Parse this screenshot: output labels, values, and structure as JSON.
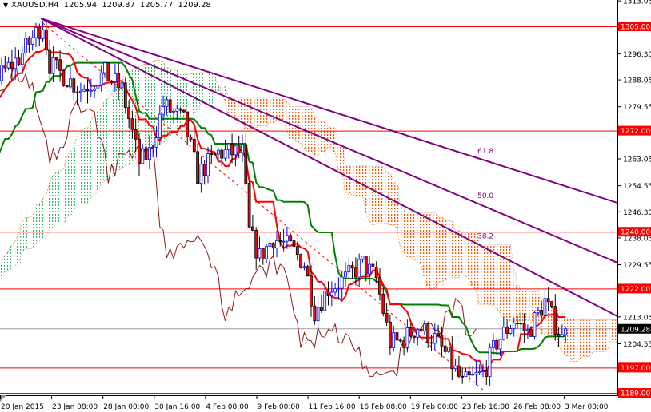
{
  "header": {
    "symbol": "XAUUSD,H4",
    "open": "1205.94",
    "high": "1209.87",
    "low": "1205.77",
    "close": "1209.28"
  },
  "chart_data": {
    "type": "candlestick",
    "title": "XAUUSD,H4",
    "ylim": [
      1187,
      1314
    ],
    "bars_visible": 165,
    "price_ticks": [
      "1313.05",
      "1296.30",
      "1288.05",
      "1279.55",
      "1263.05",
      "1254.55",
      "1246.30",
      "1238.05",
      "1229.55",
      "1213.05",
      "1204.55"
    ],
    "time_ticks": [
      "20 Jan 2015",
      "23 Jan 08:00",
      "28 Jan 00:00",
      "30 Jan 16:00",
      "4 Feb 08:00",
      "9 Feb 00:00",
      "11 Feb 16:00",
      "16 Feb 08:00",
      "19 Feb 00:00",
      "23 Feb 16:00",
      "26 Feb 08:00",
      "3 Mar 00:00"
    ],
    "horizontal_levels": [
      {
        "price": 1305.0,
        "label": "1305.00"
      },
      {
        "price": 1272.0,
        "label": "1272.00"
      },
      {
        "price": 1240.0,
        "label": "1240.00"
      },
      {
        "price": 1222.0,
        "label": "1222.00"
      },
      {
        "price": 1197.0,
        "label": "1197.00"
      },
      {
        "price": 1189.0,
        "label": "1189.00"
      }
    ],
    "current_price": {
      "price": 1209.28,
      "label": "1209.28"
    },
    "fan_lines": [
      {
        "label": "61.8",
        "start": [
          11.5,
          1307.5
        ],
        "end": [
          179.5,
          1249
        ],
        "label_bar": 137
      },
      {
        "label": "50.0",
        "start": [
          11.5,
          1307.5
        ],
        "end": [
          179.5,
          1230
        ],
        "label_bar": 137
      },
      {
        "label": "38.2",
        "start": [
          11.5,
          1307.5
        ],
        "end": [
          179.5,
          1213
        ],
        "label_bar": 137
      }
    ],
    "dashed_trend": {
      "start": [
        12,
        1306
      ],
      "end": [
        140,
        1190
      ]
    },
    "prehistory_closes": [
      [
        -52,
        1212
      ],
      [
        -40,
        1222
      ],
      [
        -30,
        1235
      ],
      [
        -20,
        1255
      ],
      [
        -10,
        1275
      ],
      [
        0,
        1290
      ]
    ],
    "key_closes": [
      [
        0,
        1290
      ],
      [
        5,
        1295
      ],
      [
        12,
        1306
      ],
      [
        14,
        1293
      ],
      [
        23,
        1285
      ],
      [
        30,
        1290
      ],
      [
        35,
        1285
      ],
      [
        40,
        1262
      ],
      [
        43,
        1265
      ],
      [
        47,
        1280
      ],
      [
        53,
        1275
      ],
      [
        57,
        1258
      ],
      [
        63,
        1265
      ],
      [
        70,
        1265
      ],
      [
        72,
        1240
      ],
      [
        75,
        1232
      ],
      [
        79,
        1238
      ],
      [
        84,
        1235
      ],
      [
        88,
        1230
      ],
      [
        91,
        1215
      ],
      [
        95,
        1222
      ],
      [
        100,
        1225
      ],
      [
        105,
        1230
      ],
      [
        109,
        1225
      ],
      [
        113,
        1205
      ],
      [
        116,
        1205
      ],
      [
        121,
        1210
      ],
      [
        126,
        1206
      ],
      [
        130,
        1200
      ],
      [
        134,
        1192
      ],
      [
        140,
        1195
      ],
      [
        144,
        1205
      ],
      [
        149,
        1212
      ],
      [
        153,
        1208
      ],
      [
        158,
        1218
      ],
      [
        163,
        1206
      ],
      [
        164,
        1209.28
      ]
    ],
    "indicators": [
      "Ichimoku Kinko Hyo (9,26,52)"
    ],
    "colors": {
      "up_candle": "#0000ff",
      "down_candle_body": "#ff0000",
      "tenkan": "#ff0000",
      "kijun": "#008000",
      "chikou": "#8b1a1a",
      "cloud_up": "#2eb85c",
      "cloud_down": "#ff5a00",
      "fan": "#800080",
      "level": "#ff0000"
    }
  }
}
